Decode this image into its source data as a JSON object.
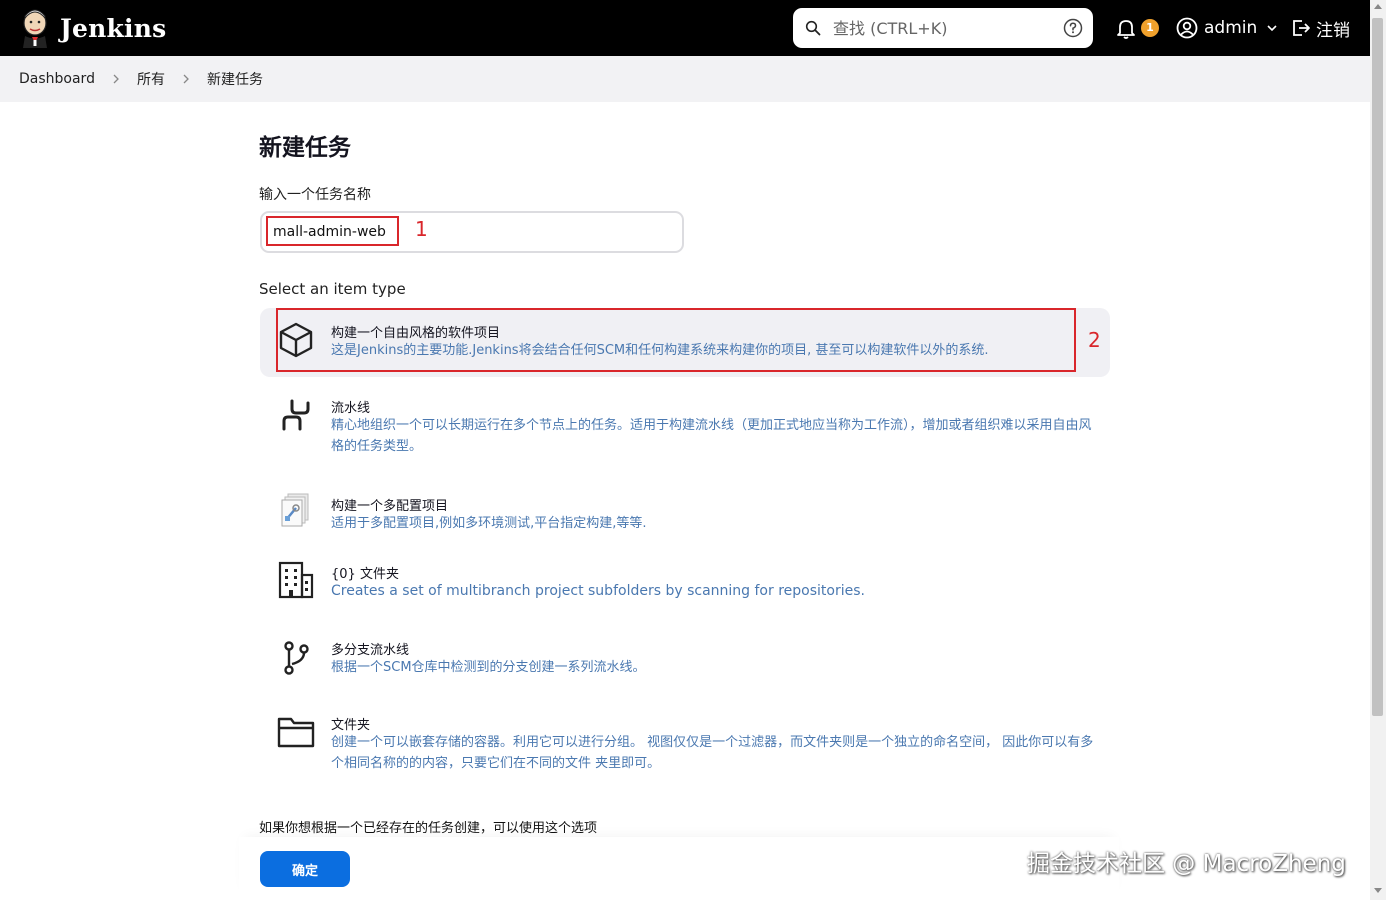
{
  "header": {
    "brand": "Jenkins",
    "search_placeholder": "查找 (CTRL+K)",
    "notification_count": "1",
    "user_name": "admin",
    "logout_label": "注销",
    "colors": {
      "bar": "#000000",
      "badge": "#f0a12c"
    }
  },
  "breadcrumb": {
    "items": [
      "Dashboard",
      "所有",
      "新建任务"
    ]
  },
  "main": {
    "title": "新建任务",
    "name_label": "输入一个任务名称",
    "name_value": "mall-admin-web",
    "annotation_1": "1",
    "annotation_2": "2",
    "type_label": "Select an item type",
    "items": [
      {
        "icon": "cube-icon",
        "title": "构建一个自由风格的软件项目",
        "desc": "这是Jenkins的主要功能.Jenkins将会结合任何SCM和任何构建系统来构建你的项目, 甚至可以构建软件以外的系统.",
        "selected": true
      },
      {
        "icon": "pipeline-icon",
        "title": "流水线",
        "desc": "精心地组织一个可以长期运行在多个节点上的任务。适用于构建流水线（更加正式地应当称为工作流），增加或者组织难以采用自由风格的任务类型。"
      },
      {
        "icon": "multi-config-icon",
        "title": "构建一个多配置项目",
        "desc": "适用于多配置项目,例如多环境测试,平台指定构建,等等."
      },
      {
        "icon": "organization-folder-icon",
        "title": "{0} 文件夹",
        "desc": "Creates a set of multibranch project subfolders by scanning for repositories."
      },
      {
        "icon": "branch-icon",
        "title": "多分支流水线",
        "desc": "根据一个SCM仓库中检测到的分支创建一系列流水线。"
      },
      {
        "icon": "folder-icon",
        "title": "文件夹",
        "desc": "创建一个可以嵌套存储的容器。利用它可以进行分组。 视图仅仅是一个过滤器，而文件夹则是一个独立的命名空间， 因此你可以有多个相同名称的的内容，只要它们在不同的文件 夹里即可。"
      }
    ],
    "copy_label": "如果你想根据一个已经存在的任务创建，可以使用这个选项",
    "ok_label": "确定",
    "colors": {
      "accent": "#0b6ee0",
      "annotation": "#d9262b",
      "desc": "#4a78b0"
    }
  },
  "watermark": "掘金技术社区 @ MacroZheng"
}
